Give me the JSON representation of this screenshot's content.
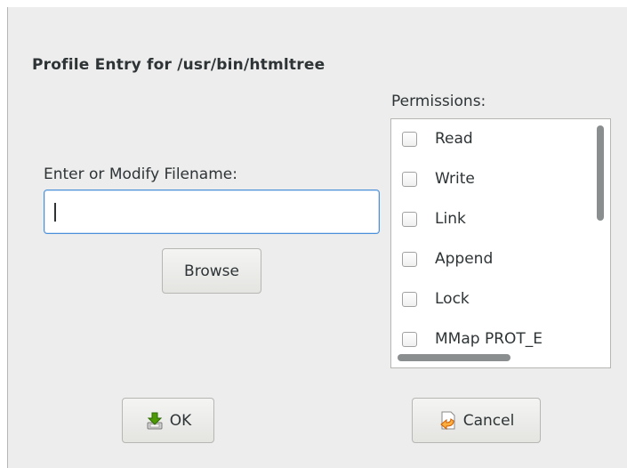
{
  "dialog": {
    "title": "Profile Entry for /usr/bin/htmltree"
  },
  "file": {
    "label": "Enter or Modify Filename:",
    "value": "",
    "browse_label": "Browse"
  },
  "permissions": {
    "label": "Permissions:",
    "items": [
      {
        "label": "Read",
        "checked": false
      },
      {
        "label": "Write",
        "checked": false
      },
      {
        "label": "Link",
        "checked": false
      },
      {
        "label": "Append",
        "checked": false
      },
      {
        "label": "Lock",
        "checked": false
      },
      {
        "label": "MMap PROT_E",
        "checked": false
      }
    ]
  },
  "buttons": {
    "ok_label": "OK",
    "cancel_label": "Cancel"
  },
  "icons": {
    "ok": "ok-download-icon",
    "cancel": "cancel-return-icon"
  },
  "colors": {
    "focus": "#4a90d9",
    "window_bg": "#ededed",
    "text": "#2e3436"
  }
}
